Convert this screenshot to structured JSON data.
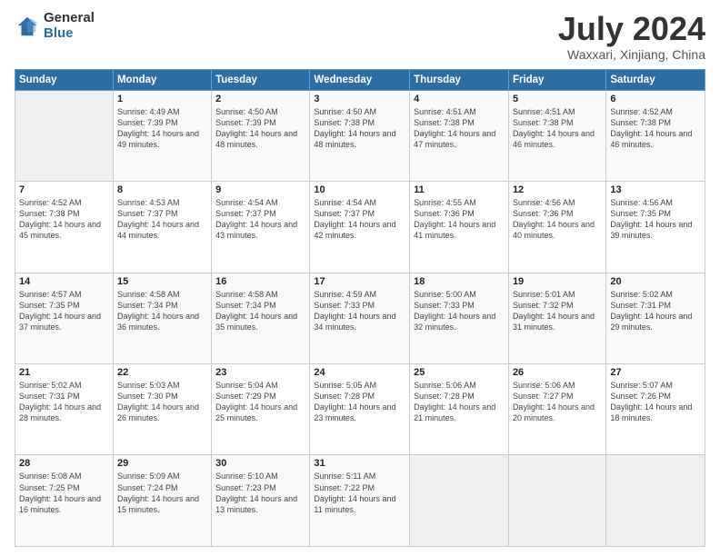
{
  "logo": {
    "general": "General",
    "blue": "Blue"
  },
  "header": {
    "title": "July 2024",
    "subtitle": "Waxxari, Xinjiang, China"
  },
  "weekdays": [
    "Sunday",
    "Monday",
    "Tuesday",
    "Wednesday",
    "Thursday",
    "Friday",
    "Saturday"
  ],
  "weeks": [
    [
      {
        "day": "",
        "sunrise": "",
        "sunset": "",
        "daylight": ""
      },
      {
        "day": "1",
        "sunrise": "Sunrise: 4:49 AM",
        "sunset": "Sunset: 7:39 PM",
        "daylight": "Daylight: 14 hours and 49 minutes."
      },
      {
        "day": "2",
        "sunrise": "Sunrise: 4:50 AM",
        "sunset": "Sunset: 7:39 PM",
        "daylight": "Daylight: 14 hours and 48 minutes."
      },
      {
        "day": "3",
        "sunrise": "Sunrise: 4:50 AM",
        "sunset": "Sunset: 7:38 PM",
        "daylight": "Daylight: 14 hours and 48 minutes."
      },
      {
        "day": "4",
        "sunrise": "Sunrise: 4:51 AM",
        "sunset": "Sunset: 7:38 PM",
        "daylight": "Daylight: 14 hours and 47 minutes."
      },
      {
        "day": "5",
        "sunrise": "Sunrise: 4:51 AM",
        "sunset": "Sunset: 7:38 PM",
        "daylight": "Daylight: 14 hours and 46 minutes."
      },
      {
        "day": "6",
        "sunrise": "Sunrise: 4:52 AM",
        "sunset": "Sunset: 7:38 PM",
        "daylight": "Daylight: 14 hours and 46 minutes."
      }
    ],
    [
      {
        "day": "7",
        "sunrise": "Sunrise: 4:52 AM",
        "sunset": "Sunset: 7:38 PM",
        "daylight": "Daylight: 14 hours and 45 minutes."
      },
      {
        "day": "8",
        "sunrise": "Sunrise: 4:53 AM",
        "sunset": "Sunset: 7:37 PM",
        "daylight": "Daylight: 14 hours and 44 minutes."
      },
      {
        "day": "9",
        "sunrise": "Sunrise: 4:54 AM",
        "sunset": "Sunset: 7:37 PM",
        "daylight": "Daylight: 14 hours and 43 minutes."
      },
      {
        "day": "10",
        "sunrise": "Sunrise: 4:54 AM",
        "sunset": "Sunset: 7:37 PM",
        "daylight": "Daylight: 14 hours and 42 minutes."
      },
      {
        "day": "11",
        "sunrise": "Sunrise: 4:55 AM",
        "sunset": "Sunset: 7:36 PM",
        "daylight": "Daylight: 14 hours and 41 minutes."
      },
      {
        "day": "12",
        "sunrise": "Sunrise: 4:56 AM",
        "sunset": "Sunset: 7:36 PM",
        "daylight": "Daylight: 14 hours and 40 minutes."
      },
      {
        "day": "13",
        "sunrise": "Sunrise: 4:56 AM",
        "sunset": "Sunset: 7:35 PM",
        "daylight": "Daylight: 14 hours and 39 minutes."
      }
    ],
    [
      {
        "day": "14",
        "sunrise": "Sunrise: 4:57 AM",
        "sunset": "Sunset: 7:35 PM",
        "daylight": "Daylight: 14 hours and 37 minutes."
      },
      {
        "day": "15",
        "sunrise": "Sunrise: 4:58 AM",
        "sunset": "Sunset: 7:34 PM",
        "daylight": "Daylight: 14 hours and 36 minutes."
      },
      {
        "day": "16",
        "sunrise": "Sunrise: 4:58 AM",
        "sunset": "Sunset: 7:34 PM",
        "daylight": "Daylight: 14 hours and 35 minutes."
      },
      {
        "day": "17",
        "sunrise": "Sunrise: 4:59 AM",
        "sunset": "Sunset: 7:33 PM",
        "daylight": "Daylight: 14 hours and 34 minutes."
      },
      {
        "day": "18",
        "sunrise": "Sunrise: 5:00 AM",
        "sunset": "Sunset: 7:33 PM",
        "daylight": "Daylight: 14 hours and 32 minutes."
      },
      {
        "day": "19",
        "sunrise": "Sunrise: 5:01 AM",
        "sunset": "Sunset: 7:32 PM",
        "daylight": "Daylight: 14 hours and 31 minutes."
      },
      {
        "day": "20",
        "sunrise": "Sunrise: 5:02 AM",
        "sunset": "Sunset: 7:31 PM",
        "daylight": "Daylight: 14 hours and 29 minutes."
      }
    ],
    [
      {
        "day": "21",
        "sunrise": "Sunrise: 5:02 AM",
        "sunset": "Sunset: 7:31 PM",
        "daylight": "Daylight: 14 hours and 28 minutes."
      },
      {
        "day": "22",
        "sunrise": "Sunrise: 5:03 AM",
        "sunset": "Sunset: 7:30 PM",
        "daylight": "Daylight: 14 hours and 26 minutes."
      },
      {
        "day": "23",
        "sunrise": "Sunrise: 5:04 AM",
        "sunset": "Sunset: 7:29 PM",
        "daylight": "Daylight: 14 hours and 25 minutes."
      },
      {
        "day": "24",
        "sunrise": "Sunrise: 5:05 AM",
        "sunset": "Sunset: 7:28 PM",
        "daylight": "Daylight: 14 hours and 23 minutes."
      },
      {
        "day": "25",
        "sunrise": "Sunrise: 5:06 AM",
        "sunset": "Sunset: 7:28 PM",
        "daylight": "Daylight: 14 hours and 21 minutes."
      },
      {
        "day": "26",
        "sunrise": "Sunrise: 5:06 AM",
        "sunset": "Sunset: 7:27 PM",
        "daylight": "Daylight: 14 hours and 20 minutes."
      },
      {
        "day": "27",
        "sunrise": "Sunrise: 5:07 AM",
        "sunset": "Sunset: 7:26 PM",
        "daylight": "Daylight: 14 hours and 18 minutes."
      }
    ],
    [
      {
        "day": "28",
        "sunrise": "Sunrise: 5:08 AM",
        "sunset": "Sunset: 7:25 PM",
        "daylight": "Daylight: 14 hours and 16 minutes."
      },
      {
        "day": "29",
        "sunrise": "Sunrise: 5:09 AM",
        "sunset": "Sunset: 7:24 PM",
        "daylight": "Daylight: 14 hours and 15 minutes."
      },
      {
        "day": "30",
        "sunrise": "Sunrise: 5:10 AM",
        "sunset": "Sunset: 7:23 PM",
        "daylight": "Daylight: 14 hours and 13 minutes."
      },
      {
        "day": "31",
        "sunrise": "Sunrise: 5:11 AM",
        "sunset": "Sunset: 7:22 PM",
        "daylight": "Daylight: 14 hours and 11 minutes."
      },
      {
        "day": "",
        "sunrise": "",
        "sunset": "",
        "daylight": ""
      },
      {
        "day": "",
        "sunrise": "",
        "sunset": "",
        "daylight": ""
      },
      {
        "day": "",
        "sunrise": "",
        "sunset": "",
        "daylight": ""
      }
    ]
  ]
}
